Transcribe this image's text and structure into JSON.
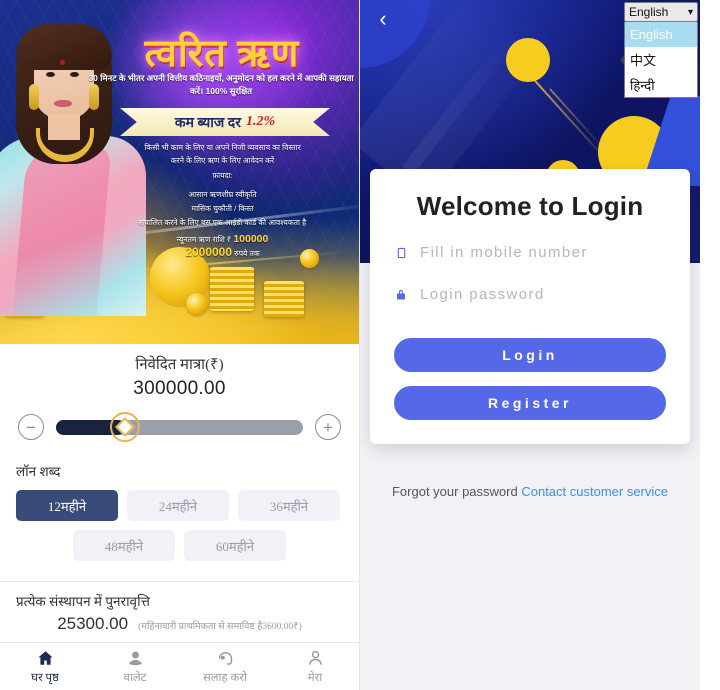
{
  "left": {
    "banner": {
      "title": "त्वरित ऋण",
      "subtitle": "30 मिनट के भीतर अपनी वित्तीय कठिनाइयों, अनुमोदन को हल करने में आपकी सहायता करें। 100% सुरक्षित",
      "ribbon_label": "कम ब्याज दर",
      "ribbon_rate": "1.2%",
      "body_line1": "किसी भी काम के लिए या अपने निजी व्यवसाय का विस्तार",
      "body_line2": "करने के लिए ऋण के लिए आवेदन करें",
      "benefits_title": "फ़ायदा:",
      "benefit1": "आसान ऋणशीघ्र स्वीकृति",
      "benefit2": "मासिक चुकौती / किस्त",
      "benefit3": "संचालित करने के लिए बस एक आईडी कार्ड की आवश्यकता है",
      "min_label": "न्यूनतम ऋण राशि ₹",
      "min_amount": "100000",
      "max_amount": "2000000",
      "max_suffix": "रुपये तक"
    },
    "amount": {
      "label": "निवेदित मात्रा(₹)",
      "value": "300000.00",
      "decrease_icon": "minus-circle-icon",
      "increase_icon": "plus-circle-icon",
      "slider_percent": 28
    },
    "terms": {
      "label": "लॉन शब्द",
      "options": [
        {
          "label": "12महीने",
          "active": true
        },
        {
          "label": "24महीने",
          "active": false
        },
        {
          "label": "36महीने",
          "active": false
        },
        {
          "label": "48महीने",
          "active": false
        },
        {
          "label": "60महीने",
          "active": false
        }
      ]
    },
    "repayment": {
      "label": "प्रत्येक संस्थापन में पुनरावृत्ति",
      "value": "25300.00",
      "note": "(महिनावारी प्राथमिकता से समाविष्ट है3600.00₹)"
    },
    "nav": [
      {
        "label": "घर पृष्ठ",
        "icon": "home-icon",
        "active": true
      },
      {
        "label": "वालेट",
        "icon": "wallet-icon",
        "active": false
      },
      {
        "label": "सलाह करो",
        "icon": "headset-support-icon",
        "active": false
      },
      {
        "label": "मेरा",
        "icon": "user-profile-icon",
        "active": false
      }
    ]
  },
  "right": {
    "back_icon": "chevron-left-icon",
    "language": {
      "selected": "English",
      "caret_icon": "chevron-down-icon",
      "options": [
        {
          "label": "English",
          "selected": true
        },
        {
          "label": "中文",
          "selected": false
        },
        {
          "label": "हिन्दी",
          "selected": false
        }
      ]
    },
    "card": {
      "title": "Welcome to Login",
      "mobile_placeholder": "Fill in mobile number",
      "mobile_icon": "mobile-phone-icon",
      "password_placeholder": "Login password",
      "password_icon": "lock-icon",
      "login_button": "Login",
      "register_button": "Register"
    },
    "footer": {
      "forgot_text": "Forgot your password",
      "contact_link": "Contact customer service"
    }
  },
  "colors": {
    "primary_blue": "#5468e8",
    "link_blue": "#3a8ef6",
    "active_term": "#394c79",
    "slider_fill": "#17233f",
    "slider_thumb": "#e8b54a",
    "gold": "#f6cc1e"
  }
}
